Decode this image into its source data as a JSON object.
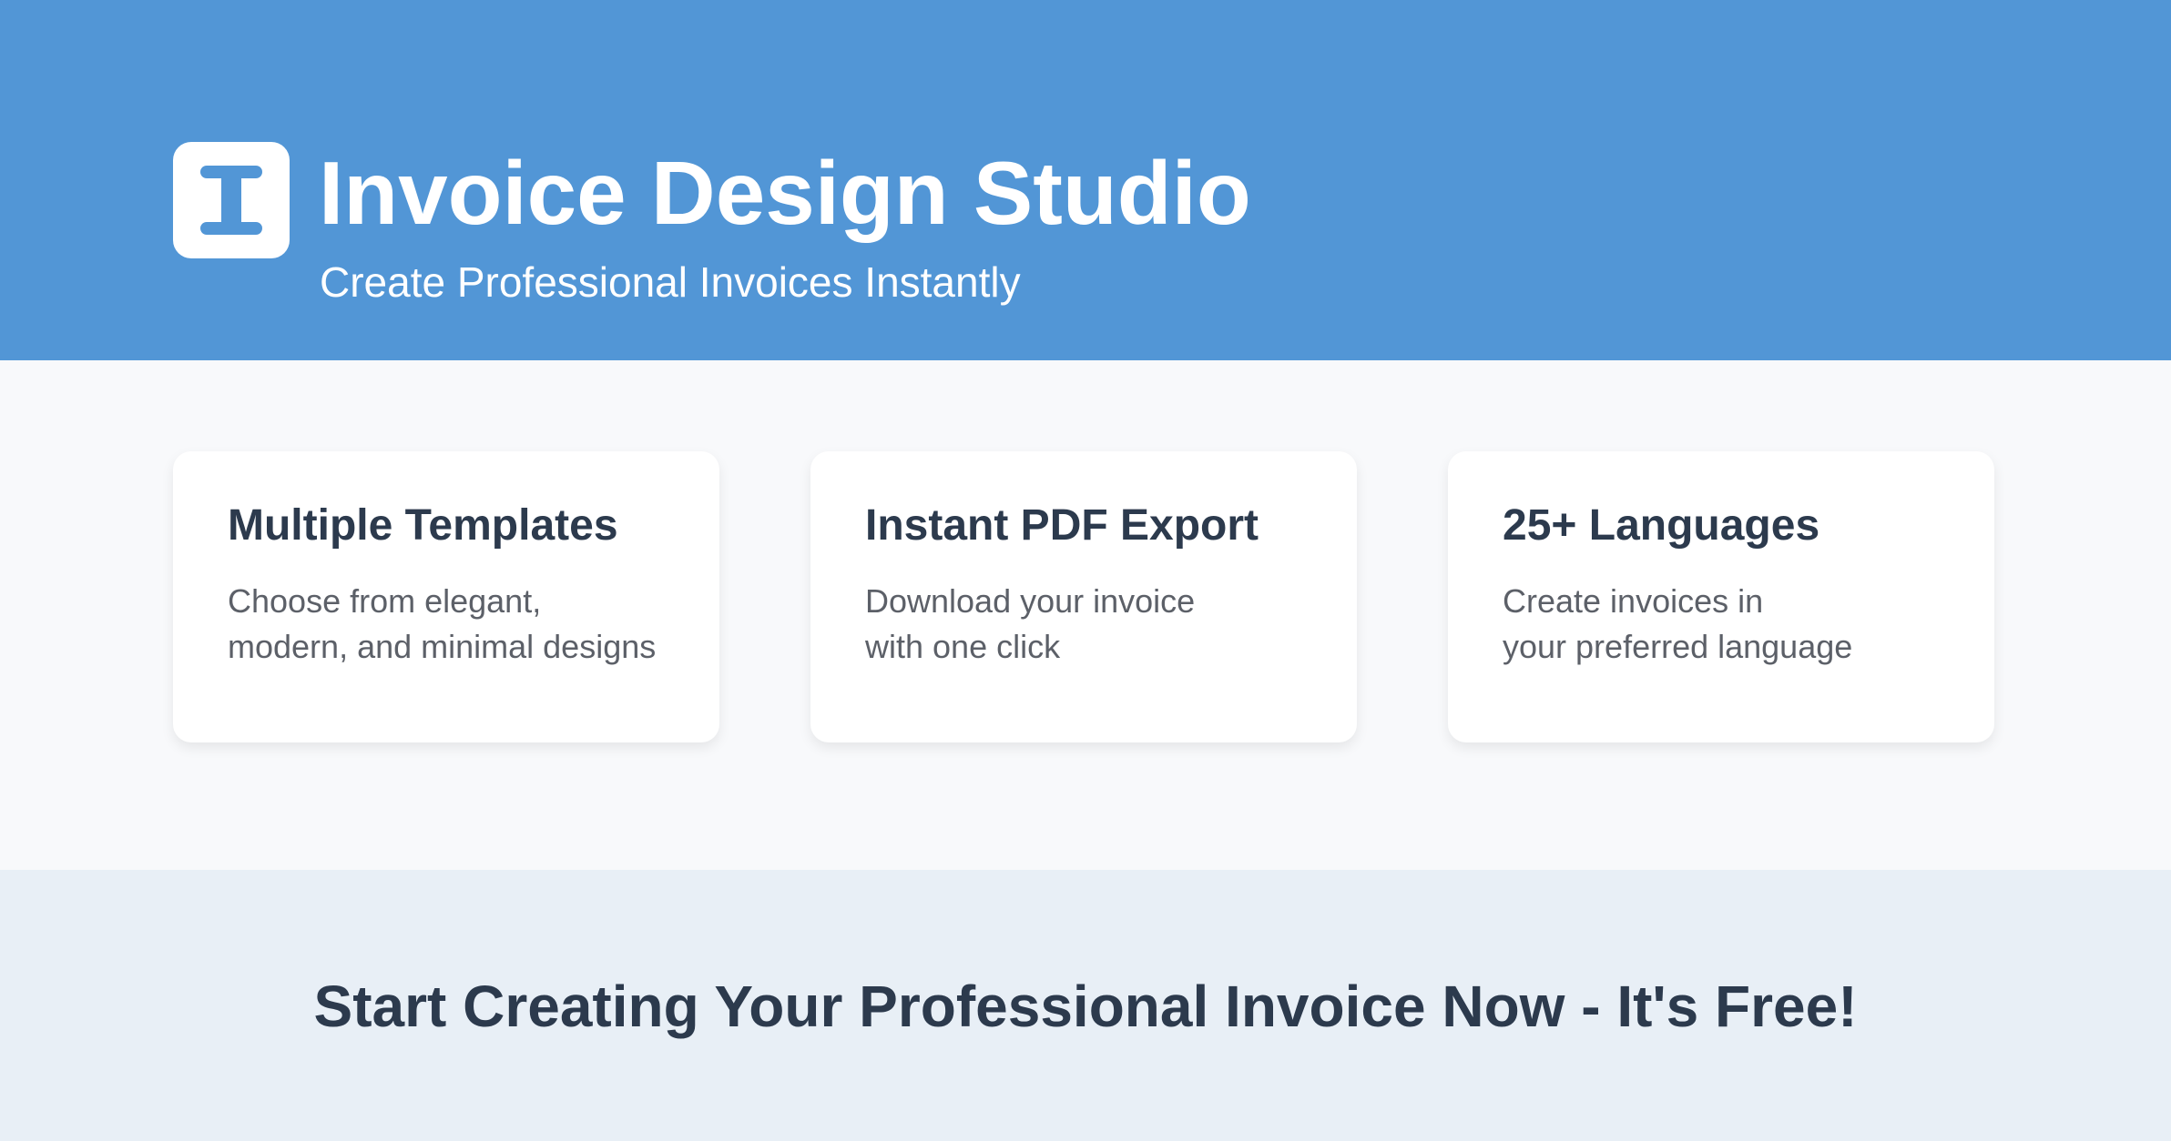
{
  "header": {
    "logo_icon": "letter-i-logo-icon",
    "title": "Invoice Design Studio",
    "subtitle": "Create Professional Invoices Instantly"
  },
  "features": [
    {
      "title": "Multiple Templates",
      "description_lines": [
        "Choose from elegant,",
        "modern, and minimal designs"
      ]
    },
    {
      "title": "Instant PDF Export",
      "description_lines": [
        "Download your invoice",
        "with one click"
      ]
    },
    {
      "title": "25+ Languages",
      "description_lines": [
        "Create invoices in",
        "your preferred language"
      ]
    }
  ],
  "cta": {
    "text": "Start Creating Your Professional Invoice Now - It's Free!"
  },
  "colors": {
    "brand": "#5296d6",
    "heading": "#2c3a4d",
    "body_text": "#5c6068",
    "card_bg": "#ffffff",
    "section_bg": "#f8f9fb",
    "cta_bg": "#e8eff6"
  }
}
